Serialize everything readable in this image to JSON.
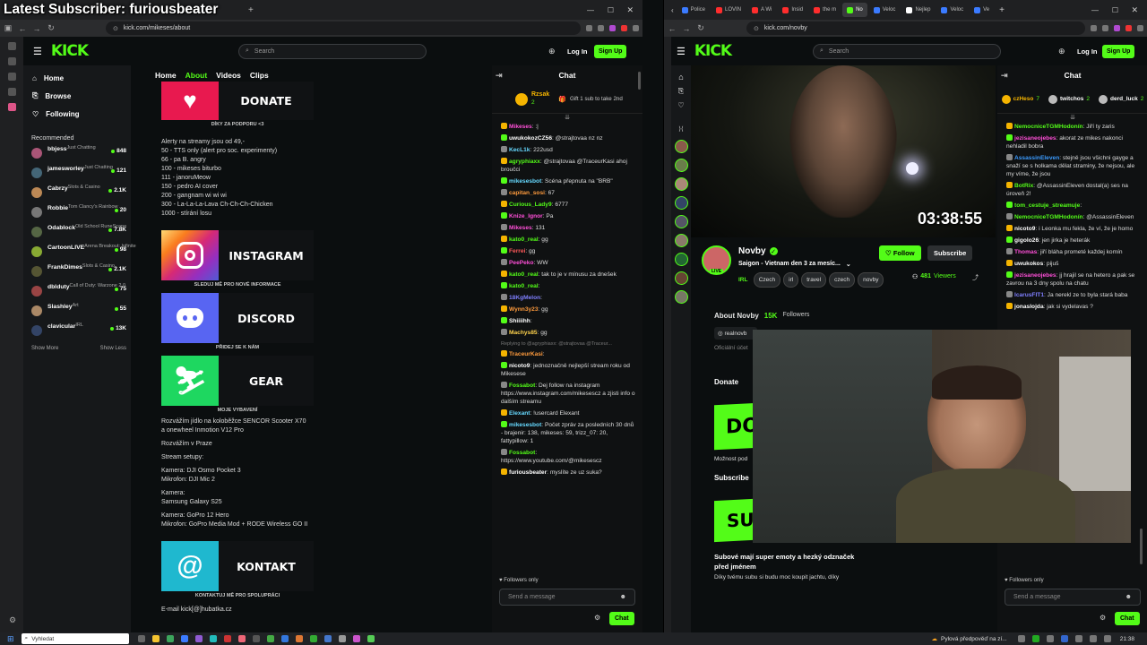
{
  "overlay": {
    "title": "Latest Subscriber: furiousbeater"
  },
  "left_window": {
    "tabs": [
      {
        "label": "",
        "active": true
      }
    ],
    "url": "kick.com/mikeses/about",
    "header": {
      "logo": "KICK",
      "search_placeholder": "Search",
      "login": "Log In",
      "signup": "Sign Up"
    },
    "sidebar": {
      "nav": [
        {
          "label": "Home",
          "icon": "home-icon"
        },
        {
          "label": "Browse",
          "icon": "browse-icon"
        },
        {
          "label": "Following",
          "icon": "heart-icon"
        }
      ],
      "recommended_label": "Recommended",
      "channels": [
        {
          "name": "bbjess",
          "category": "Just Chatting",
          "viewers": "848"
        },
        {
          "name": "jamesworley",
          "category": "Just Chatting",
          "viewers": "121"
        },
        {
          "name": "Cabrzy",
          "category": "Slots & Casino",
          "viewers": "2.1K"
        },
        {
          "name": "Robbie",
          "category": "Tom Clancy's Rainbow ...",
          "viewers": "20"
        },
        {
          "name": "Odablock",
          "category": "Old School RuneScape",
          "viewers": "7.8K"
        },
        {
          "name": "CartoonLIVE",
          "category": "Arena Breakout: Infinite",
          "viewers": "98"
        },
        {
          "name": "FrankDimes",
          "category": "Slots & Casino",
          "viewers": "2.1K"
        },
        {
          "name": "dblduty",
          "category": "Call of Duty: Warzone 2.0",
          "viewers": "75"
        },
        {
          "name": "Slashley",
          "category": "Art",
          "viewers": "55"
        },
        {
          "name": "clavicular",
          "category": "IRL",
          "viewers": "13K"
        }
      ],
      "show_more": "Show More",
      "show_less": "Show Less"
    },
    "channel_tabs": [
      "Home",
      "About",
      "Videos",
      "Clips"
    ],
    "active_tab": "About",
    "about": {
      "donate_label": "DONATE",
      "donate_caption": "DÍKY ZA PODPORU <3",
      "alerts": [
        "Alerty na streamy jsou od 49,-",
        "50 - TTS only (alert pro soc. experimenty)",
        "66 - pa B. angry",
        "100 - mikeses biturbo",
        "111 - janoruMeow",
        "150 - pedro AI cover",
        "200 - gangnam wi wi wi",
        "300 - La-La-La-Lava Ch-Ch-Ch-Chicken",
        "1000 - stírání losu"
      ],
      "instagram_label": "INSTAGRAM",
      "instagram_caption": "SLEDUJ MĚ PRO NOVÉ INFORMACE",
      "discord_label": "DISCORD",
      "discord_caption": "PŘIDEJ SE K NÁM",
      "gear_label": "GEAR",
      "gear_caption": "MOJE VYBAVENÍ",
      "gear_text": [
        "Rozvážím jídlo na koloběžce SENCOR Scooter X70",
        "a onewheel Inmotion V12 Pro",
        "",
        "Rozvážím v Praze",
        "",
        "Stream setupy:",
        "",
        "Kamera: DJI Osmo Pocket 3",
        "Mikrofon: DJI Mic 2",
        "",
        "Kamera:",
        "Samsung Galaxy S25",
        "",
        "Kamera: GoPro 12 Hero",
        "Mikrofon: GoPro Media Mod + RODE Wireless GO II"
      ],
      "contact_label": "KONTAKT",
      "contact_caption": "KONTAKTUJ MĚ PRO SPOLUPRÁCI",
      "email_line": "E-mail kick[@]hubatka.cz"
    },
    "chat": {
      "title": "Chat",
      "pinned_user": "Rzsak",
      "pinned_count": "2",
      "pinned_text": "Gift 1 sub to take 2nd",
      "messages": [
        {
          "user": "Mikeses",
          "color": "#ff4fd8",
          "text": ":|"
        },
        {
          "user": "uwukokozCZ56",
          "color": "#ffffff",
          "text": "@strajtovaa nz nz"
        },
        {
          "user": "KecL1k",
          "color": "#66d9ff",
          "text": "222usd"
        },
        {
          "user": "agryphiaxx",
          "color": "#53fc18",
          "text": "@strajtovaa @TraceurKasi ahoj broučci"
        },
        {
          "user": "mikesesbot",
          "color": "#66d9ff",
          "text": "Scéna přepnuta na \"BRB\""
        },
        {
          "user": "capitan_sosi",
          "color": "#ff9b3d",
          "text": "67"
        },
        {
          "user": "Curious_Lady9",
          "color": "#53fc18",
          "text": "6777"
        },
        {
          "user": "Knize_Ignor",
          "color": "#ff4fd8",
          "text": "Pa"
        },
        {
          "user": "Mikeses",
          "color": "#ff4fd8",
          "text": "131"
        },
        {
          "user": "kato0_real",
          "color": "#53fc18",
          "text": "gg"
        },
        {
          "user": "Ferrei",
          "color": "#ff5a5a",
          "text": "gg"
        },
        {
          "user": "PeePeko",
          "color": "#ff4fd8",
          "text": "WW"
        },
        {
          "user": "kato0_real",
          "color": "#53fc18",
          "text": "tak to je v mínusu za dnešek"
        },
        {
          "user": "kato0_real",
          "color": "#53fc18",
          "text": ""
        },
        {
          "user": "18KgMelon",
          "color": "#7f7fff",
          "text": ""
        },
        {
          "user": "Wynn3y23",
          "color": "#ff9b3d",
          "text": "gg"
        },
        {
          "user": "Shiiiihh",
          "color": "#ffffff",
          "text": ""
        },
        {
          "user": "Machys85",
          "color": "#ffd34d",
          "text": "gg"
        },
        {
          "user": "TraceurKasi",
          "color": "#ff9b3d",
          "text": "",
          "reply": "Replying to @agryphiaxx: @strajtovaa @Traceur..."
        },
        {
          "user": "nicoto9",
          "color": "#ffffff",
          "text": "jednoznačně nejlepší stream roku od Mikesese"
        },
        {
          "user": "Fossabot",
          "color": "#53fc18",
          "text": "Dej follow na instagram https://www.instagram.com/mikesescz a zjisti info o dalším streamu"
        },
        {
          "user": "Elexant",
          "color": "#66d9ff",
          "text": "!usercard Elexant"
        },
        {
          "user": "mikesesbot",
          "color": "#66d9ff",
          "text": "Počet zpráv za posledních 30 dnů - brajenir: 138, mikeses: 59, trizz_07: 20, fattypillow: 1"
        },
        {
          "user": "Fossabot",
          "color": "#53fc18",
          "text": "https://www.youtube.com/@mikesescz"
        },
        {
          "user": "furiousbeater",
          "color": "#ffffff",
          "text": "myslíte ze uz suka?"
        }
      ],
      "followers_only": "Followers only",
      "input_placeholder": "Send a message",
      "send_label": "Chat"
    }
  },
  "right_window": {
    "tabs": [
      {
        "label": "Police",
        "color": "#3b7bff"
      },
      {
        "label": "LOVIN",
        "color": "#ff2d2d"
      },
      {
        "label": "A Wi",
        "color": "#ff2d2d"
      },
      {
        "label": "Insid",
        "color": "#ff2d2d"
      },
      {
        "label": "the m",
        "color": "#ff2d2d"
      },
      {
        "label": "No",
        "color": "#53fc18",
        "active": true
      },
      {
        "label": "Veloc",
        "color": "#3b7bff"
      },
      {
        "label": "Nejlep",
        "color": "#ffffff"
      },
      {
        "label": "Veloc",
        "color": "#3b7bff"
      },
      {
        "label": "Ve",
        "color": "#3b7bff"
      }
    ],
    "url": "kick.com/novby",
    "header": {
      "logo": "KICK",
      "search_placeholder": "Search",
      "login": "Log In",
      "signup": "Sign Up"
    },
    "stream": {
      "timer": "03:38:55",
      "channel": "Novby",
      "title": "Saigon - Vietnam den 3 za mesíc...",
      "category": "IRL",
      "tags": [
        "Czech",
        "irl",
        "travel",
        "czech",
        "novby"
      ],
      "viewers": "481",
      "viewers_label": "Viewers",
      "follow": "Follow",
      "subscribe": "Subscribe",
      "live": "LIVE"
    },
    "about": {
      "title": "About Novby",
      "followers": "15K",
      "followers_label": "Followers",
      "instagram": "realnovb",
      "official": "Oficiální účet",
      "donate_heading": "Donate",
      "donate_banner": "DO",
      "more_text": "Možnost pod",
      "subscribe_heading": "Subscribe",
      "subscribe_banner": "SUBSCRIBE",
      "sub_text_1": "Subové mají super emoty a hezký odznaček před jménem",
      "sub_text_2": "Díky tvému subu si budu moc koupit jachtu, díky"
    },
    "chat": {
      "title": "Chat",
      "pinned": [
        {
          "user": "czHeso",
          "count": "7"
        },
        {
          "user": "twitchos",
          "count": "2"
        },
        {
          "user": "derd_luck",
          "count": "2"
        }
      ],
      "messages": [
        {
          "user": "NemocniceTGMHodonín",
          "color": "#53fc18",
          "text": "Jiří ty zaris"
        },
        {
          "user": "jezisaneojebes",
          "color": "#ff4fd8",
          "text": "akorat ze mikes nakonci nehladil bobra"
        },
        {
          "user": "AssassinEleven",
          "color": "#3b9bff",
          "text": "stejně jsou všichni gayge a snaží se s holkama dělat straminy, že nejsou, ale my víme, že jsou"
        },
        {
          "user": "BotRix",
          "color": "#53fc18",
          "text": "@AssassinEleven dostal(a) ses na úroveň 2!"
        },
        {
          "user": "tom_cestuje_streamuje",
          "color": "#53fc18",
          "text": ""
        },
        {
          "user": "NemocniceTGMHodonín",
          "color": "#53fc18",
          "text": "@AssassinEleven"
        },
        {
          "user": "nicoto9",
          "color": "#ffffff",
          "text": "i Leonka mu fekla, že ví, že je homo"
        },
        {
          "user": "gigolo26",
          "color": "#ffffff",
          "text": "jen jirka je heterák"
        },
        {
          "user": "Thomas",
          "color": "#ff4fd8",
          "text": "jiří bláha prometé každej komín"
        },
        {
          "user": "uwukokos",
          "color": "#ffffff",
          "text": "pijuš"
        },
        {
          "user": "jezisaneojebes",
          "color": "#ff4fd8",
          "text": "jj hrajil se na hetero a pak se zavrou na 3 dny spolu na chatu"
        },
        {
          "user": "IcarusFIT1",
          "color": "#7f7fff",
          "text": "Ja nerekl ze to byla stará baba"
        },
        {
          "user": "jonaslojda",
          "color": "#ffffff",
          "text": "jak si vydelavas ?"
        }
      ],
      "followers_only": "Followers only",
      "input_placeholder": "Send a message",
      "send_label": "Chat"
    }
  },
  "taskbar": {
    "search_placeholder": "Vyhledat",
    "weather": "Pylová předpověď na zí...",
    "time": "21:38"
  }
}
